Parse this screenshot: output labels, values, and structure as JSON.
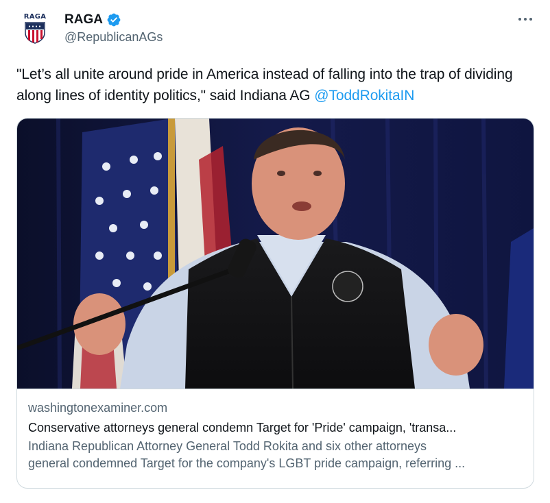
{
  "author": {
    "avatar_text": "RAGA",
    "display_name": "RAGA",
    "handle": "@RepublicanAGs",
    "verified_icon": "verified-badge-icon"
  },
  "tweet": {
    "text_before": "\"Let’s all unite around pride in America instead of falling into the trap of dividing along lines of identity politics,\" said Indiana AG ",
    "mention": "@ToddRokitaIN"
  },
  "card": {
    "domain": "washingtonexaminer.com",
    "title": "Conservative attorneys general condemn Target for 'Pride' campaign, 'transa...",
    "description_line1": "Indiana Republican Attorney General Todd Rokita and six other attorneys",
    "description_line2": "general condemned Target for the company's LGBT pride campaign, referring ..."
  },
  "colors": {
    "link_blue": "#1d9bf0",
    "secondary_text": "#536471",
    "border": "#cfd9de"
  }
}
